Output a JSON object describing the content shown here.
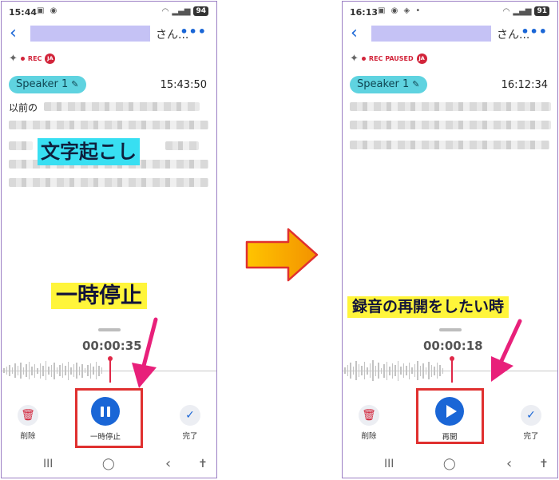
{
  "left": {
    "status_time": "15:44",
    "status_battery": "94",
    "title_suffix": "さん...",
    "rec_label": "REC",
    "lang_badge": "JA",
    "speaker_label": "Speaker 1",
    "timestamp": "15:43:50",
    "transcript_start": "以前の",
    "overlay_transcribe": "文字起こし",
    "overlay_action": "一時停止",
    "timer": "00:00:35",
    "delete_label": "削除",
    "main_label": "一時停止",
    "done_label": "完了"
  },
  "right": {
    "status_time": "16:13",
    "status_battery": "91",
    "title_suffix": "さん...",
    "rec_label": "REC PAUSED",
    "lang_badge": "JA",
    "speaker_label": "Speaker 1",
    "timestamp": "16:12:34",
    "overlay_action": "録音の再開をしたい時",
    "timer": "00:00:18",
    "delete_label": "削除",
    "main_label": "再開",
    "done_label": "完了"
  },
  "icons": {
    "back": "‹",
    "more": "•••",
    "sparkle": "✦",
    "pencil": "✎",
    "trash": "🗑",
    "check": "✓",
    "nav_recents": "III",
    "nav_home": "◯",
    "nav_back": "‹",
    "nav_accessibility": "✝"
  },
  "colors": {
    "accent_blue": "#1a66d6",
    "rec_red": "#d2243a",
    "speaker_chip": "#5fd3e0",
    "highlight_yellow": "#fff53a",
    "highlight_cyan": "#38dff2",
    "arrow_orange": "#f6a000",
    "arrow_magenta": "#e8207a"
  }
}
